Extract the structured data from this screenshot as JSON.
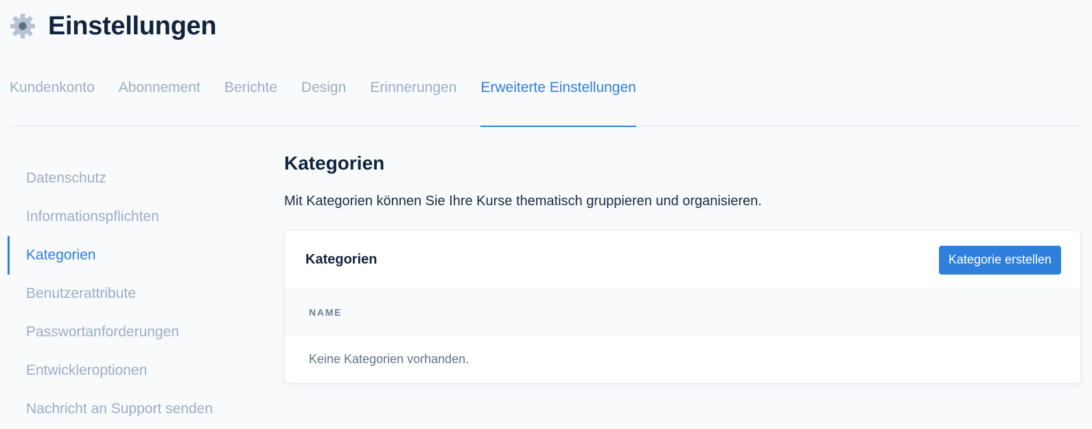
{
  "header": {
    "title": "Einstellungen",
    "icon": "gear-icon"
  },
  "tabs": [
    {
      "label": "Kundenkonto",
      "active": false
    },
    {
      "label": "Abonnement",
      "active": false
    },
    {
      "label": "Berichte",
      "active": false
    },
    {
      "label": "Design",
      "active": false
    },
    {
      "label": "Erinnerungen",
      "active": false
    },
    {
      "label": "Erweiterte Einstellungen",
      "active": true
    }
  ],
  "sidebar": {
    "items": [
      {
        "label": "Datenschutz",
        "active": false
      },
      {
        "label": "Informationspflichten",
        "active": false
      },
      {
        "label": "Kategorien",
        "active": true
      },
      {
        "label": "Benutzerattribute",
        "active": false
      },
      {
        "label": "Passwortanforderungen",
        "active": false
      },
      {
        "label": "Entwickleroptionen",
        "active": false
      },
      {
        "label": "Nachricht an Support senden",
        "active": false
      }
    ]
  },
  "main": {
    "title": "Kategorien",
    "description": "Mit Kategorien können Sie Ihre Kurse thematisch gruppieren und organisieren.",
    "card": {
      "title": "Kategorien",
      "create_button": "Kategorie erstellen",
      "columns": [
        "NAME"
      ],
      "empty_text": "Keine Kategorien vorhanden."
    }
  },
  "colors": {
    "accent": "#2f7fdd",
    "muted_text": "#9daec3",
    "heading": "#12233b",
    "background": "#f8fafc"
  }
}
